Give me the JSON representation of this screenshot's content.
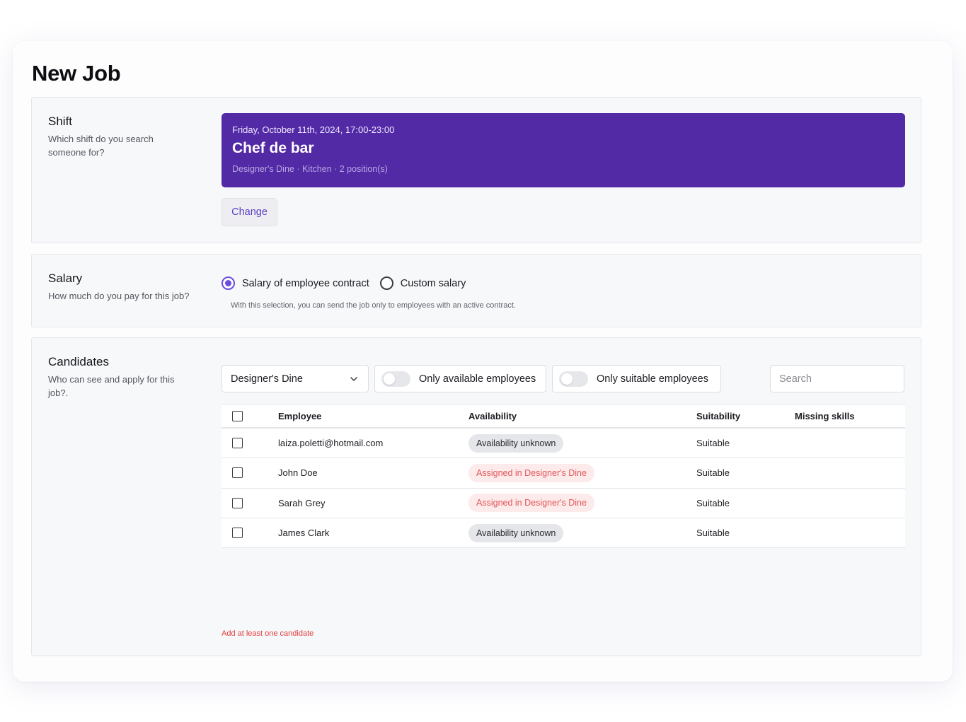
{
  "page": {
    "title": "New Job"
  },
  "shift": {
    "title": "Shift",
    "description": "Which shift do you search someone for?",
    "date": "Friday, October 11th, 2024, 17:00-23:00",
    "role": "Chef de bar",
    "meta": "Designer's Dine · Kitchen · 2 position(s)",
    "change_label": "Change",
    "card_color": "#532aa6"
  },
  "salary": {
    "title": "Salary",
    "description": "How much do you pay for this job?",
    "options": [
      {
        "label": "Salary of employee contract",
        "checked": true
      },
      {
        "label": "Custom salary",
        "checked": false
      }
    ],
    "note": "With this selection, you can send the job only to employees with an active contract."
  },
  "candidates": {
    "title": "Candidates",
    "description": "Who can see and apply for this job?.",
    "location_select": "Designer's Dine",
    "toggle_available": "Only available employees",
    "toggle_suitable": "Only suitable employees",
    "search_placeholder": "Search",
    "columns": {
      "employee": "Employee",
      "availability": "Availability",
      "suitability": "Suitability",
      "missing": "Missing skills"
    },
    "rows": [
      {
        "employee": "laiza.poletti@hotmail.com",
        "availability": "Availability unknown",
        "status": "unknown",
        "suitability": "Suitable",
        "missing": ""
      },
      {
        "employee": "John Doe",
        "availability": "Assigned in Designer's Dine",
        "status": "assigned",
        "suitability": "Suitable",
        "missing": ""
      },
      {
        "employee": "Sarah Grey",
        "availability": "Assigned in Designer's Dine",
        "status": "assigned",
        "suitability": "Suitable",
        "missing": ""
      },
      {
        "employee": "James Clark",
        "availability": "Availability unknown",
        "status": "unknown",
        "suitability": "Suitable",
        "missing": ""
      }
    ],
    "error": "Add at least one candidate"
  },
  "colors": {
    "accent": "#6a4ce0",
    "error": "#e23b3b",
    "assigned_text": "#e0575b"
  }
}
